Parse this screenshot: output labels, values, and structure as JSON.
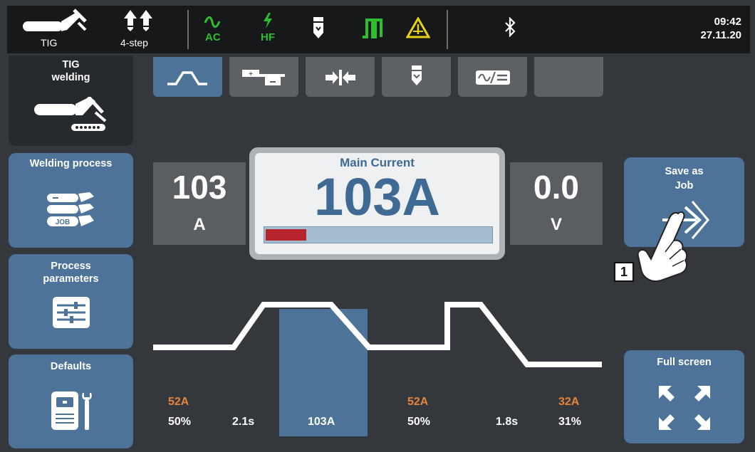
{
  "statusbar": {
    "process_label": "TIG",
    "mode_label": "4-step",
    "ac_label": "AC",
    "hf_label": "HF",
    "time": "09:42",
    "date": "27.11.20",
    "icons": [
      "tig-torch-icon",
      "4-step-mode-icon",
      "ac-wave-icon",
      "hf-lightning-icon",
      "electrode-icon",
      "pulse-wave-icon",
      "warning-icon",
      "bluetooth-icon"
    ],
    "accent_green": "#2ebd2e"
  },
  "sidebar": {
    "items": [
      {
        "label": "TIG\nwelding",
        "icon": "tig-torch-icon"
      },
      {
        "label": "Welding process",
        "icon": "welding-process-job-icon"
      },
      {
        "label": "Process\nparameters",
        "icon": "sliders-icon"
      },
      {
        "label": "Defaults",
        "icon": "welding-machine-wrench-icon"
      }
    ]
  },
  "tabs": [
    {
      "icon": "ramp-profile-icon",
      "active": true
    },
    {
      "icon": "polarity-icon",
      "active": false
    },
    {
      "icon": "arc-length-icon",
      "active": false
    },
    {
      "icon": "electrode-icon",
      "active": false
    },
    {
      "icon": "ac-dc-icon",
      "active": false
    },
    {
      "icon": "",
      "active": false
    }
  ],
  "display": {
    "left_value": "103",
    "left_unit": "A",
    "main_title": "Main Current",
    "main_value": "103A",
    "main_progress": 0.18,
    "right_value": "0.0",
    "right_unit": "V",
    "progress_color": "#b8242c"
  },
  "actions": {
    "save_job_label": "Save as\nJob",
    "full_screen_label": "Full screen",
    "callout_number": "1"
  },
  "profile": {
    "params": [
      {
        "top": "52A",
        "bottom": "50%"
      },
      {
        "top": "",
        "bottom": "2.1s"
      },
      {
        "top": "",
        "bottom": "103A",
        "selected": true
      },
      {
        "top": "52A",
        "bottom": "50%"
      },
      {
        "top": "",
        "bottom": "1.8s"
      },
      {
        "top": "32A",
        "bottom": "31%"
      }
    ]
  },
  "colors": {
    "accent_blue": "#4e7398",
    "orange": "#e8833a",
    "background": "#34383d"
  }
}
